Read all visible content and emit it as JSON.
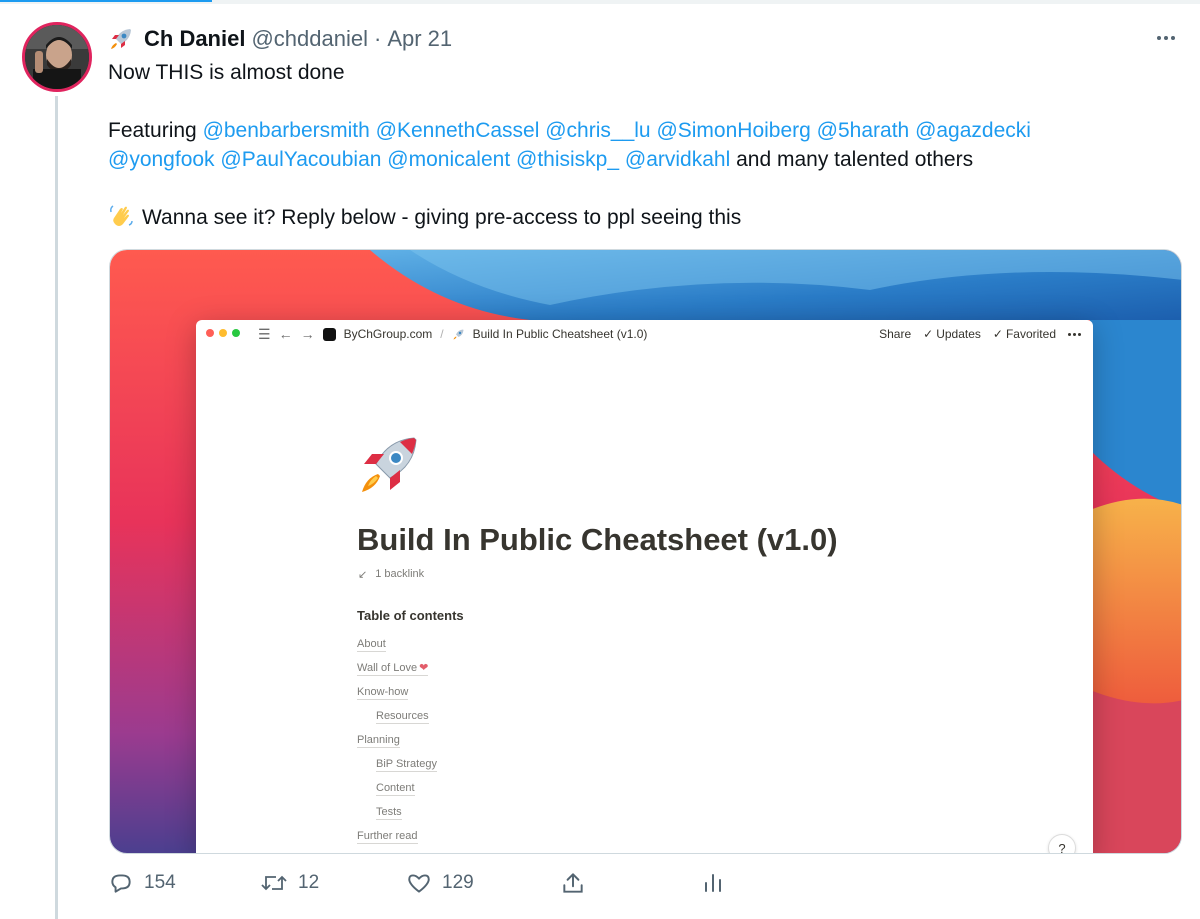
{
  "tweet": {
    "author": {
      "display_name": "Ch Daniel",
      "handle": "@chddaniel",
      "separator": "·",
      "date": "Apr 21",
      "name_icon": "rocket-emoji"
    },
    "text": {
      "line1": "Now THIS is almost done",
      "featuring_label": "Featuring ",
      "mentions_line1": [
        "@benbarbersmith",
        "@KennethCassel",
        "@chris__lu",
        "@SimonHoiberg",
        "@5harath",
        "@agazdecki"
      ],
      "mentions_line2": [
        "@yongfook",
        "@PaulYacoubian",
        "@monicalent",
        "@thisiskp_",
        "@arvidkahl"
      ],
      "line2_tail": " and many talented others",
      "wave_icon": "waving-hand-emoji",
      "line3": "Wanna see it? Reply below - giving pre-access to ppl seeing this"
    },
    "actions": {
      "replies": "154",
      "retweets": "12",
      "likes": "129"
    },
    "colors": {
      "accent": "#1d9bf0",
      "muted": "#536471",
      "avatar_ring": "#e0245e"
    }
  },
  "screenshot": {
    "breadcrumb_site": "ByChGroup.com",
    "breadcrumb_separator": "/",
    "breadcrumb_page": "Build In Public Cheatsheet (v1.0)",
    "toolbar": {
      "share": "Share",
      "updates": "Updates",
      "favorited": "Favorited",
      "check": "✓"
    },
    "page_title": "Build In Public Cheatsheet (v1.0)",
    "backlink": "1 backlink",
    "backlink_arrow": "↙",
    "toc_heading": "Table of contents",
    "toc": [
      {
        "label": "About",
        "indent": false
      },
      {
        "label": "Wall of Love",
        "indent": false,
        "suffix": "❤"
      },
      {
        "label": "Know-how",
        "indent": false
      },
      {
        "label": "Resources",
        "indent": true
      },
      {
        "label": "Planning",
        "indent": false
      },
      {
        "label": "BiP Strategy",
        "indent": true
      },
      {
        "label": "Content",
        "indent": true
      },
      {
        "label": "Tests",
        "indent": true
      },
      {
        "label": "Further read",
        "indent": false
      }
    ],
    "help": "?"
  }
}
